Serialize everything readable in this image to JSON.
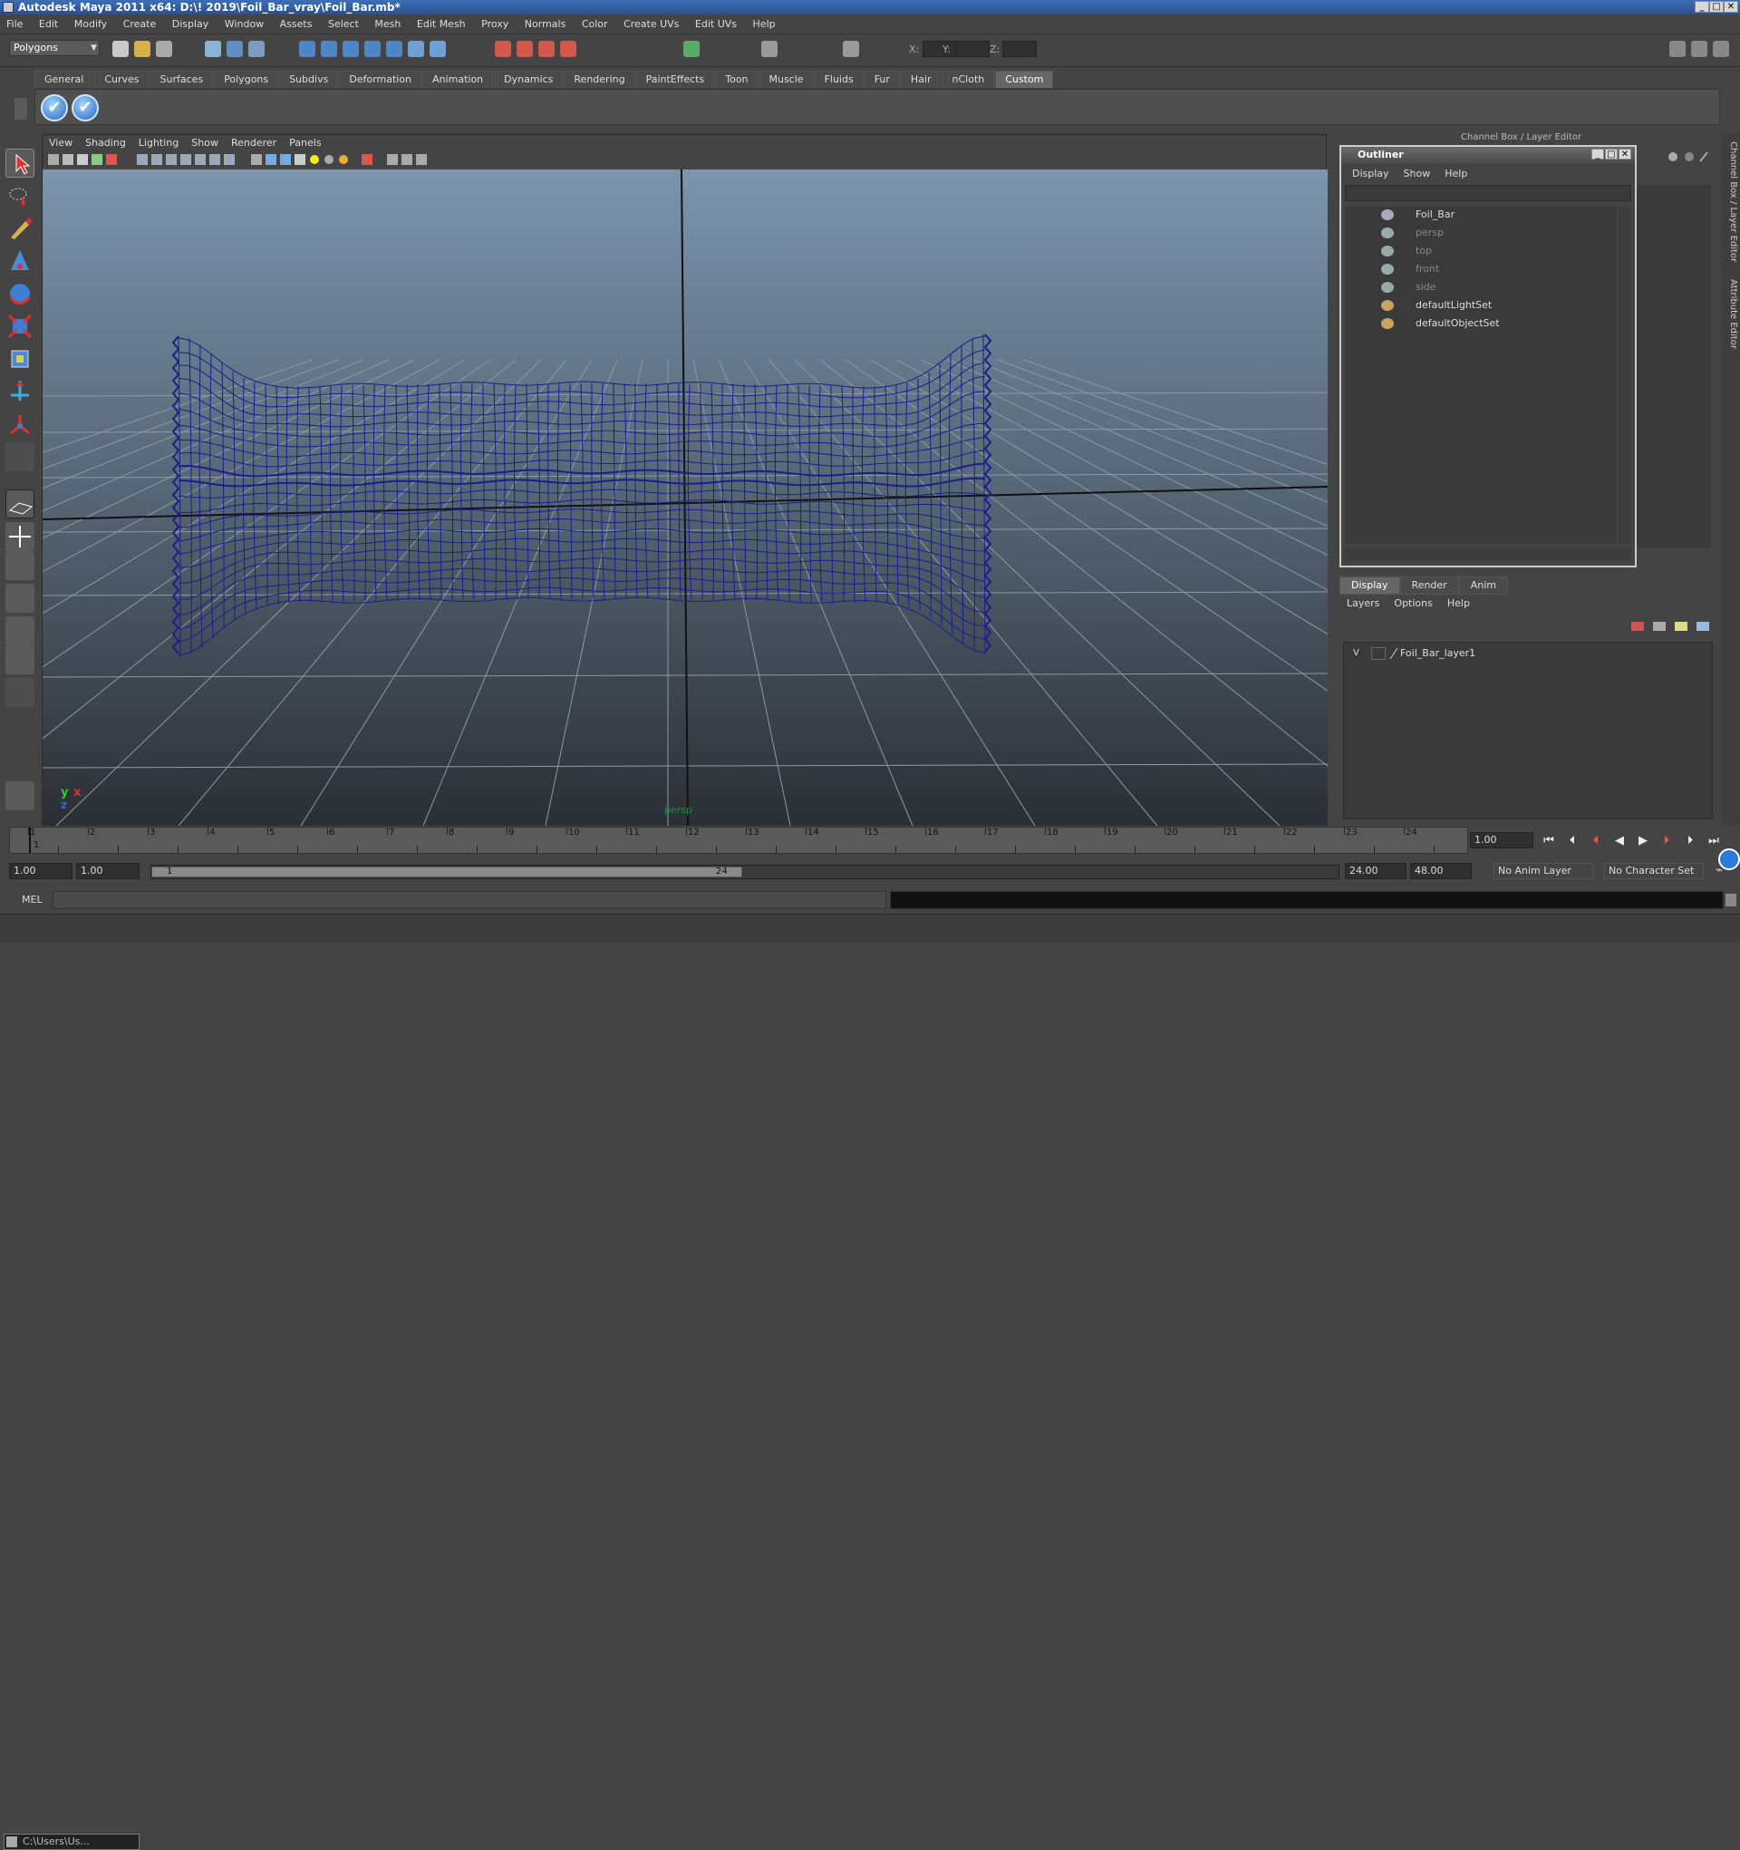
{
  "window": {
    "title": "Autodesk Maya 2011 x64: D:\\! 2019\\Foil_Bar_vray\\Foil_Bar.mb*",
    "minimize": "_",
    "maximize": "□",
    "close": "✕"
  },
  "menubar": [
    "File",
    "Edit",
    "Modify",
    "Create",
    "Display",
    "Window",
    "Assets",
    "Select",
    "Mesh",
    "Edit Mesh",
    "Proxy",
    "Normals",
    "Color",
    "Create UVs",
    "Edit UVs",
    "Help"
  ],
  "statusline": {
    "mode": "Polygons",
    "x_label": "X:",
    "y_label": "Y:",
    "z_label": "Z:"
  },
  "shelf": {
    "tabs": [
      "General",
      "Curves",
      "Surfaces",
      "Polygons",
      "Subdivs",
      "Deformation",
      "Animation",
      "Dynamics",
      "Rendering",
      "PaintEffects",
      "Toon",
      "Muscle",
      "Fluids",
      "Fur",
      "Hair",
      "nCloth",
      "Custom"
    ],
    "active_tab": "Custom",
    "buttons": [
      "✔",
      "✔"
    ]
  },
  "viewport": {
    "menus": [
      "View",
      "Shading",
      "Lighting",
      "Show",
      "Renderer",
      "Panels"
    ],
    "camera_label": "persp",
    "axis_y": "y",
    "axis_x": "x",
    "axis_z": "z",
    "wire_color": "#1a1e8a"
  },
  "channelbox": {
    "title": "Channel Box / Layer Editor"
  },
  "outliner": {
    "title": "Outliner",
    "menus": [
      "Display",
      "Show",
      "Help"
    ],
    "items": [
      {
        "label": "Foil_Bar",
        "dim": false
      },
      {
        "label": "persp",
        "dim": true
      },
      {
        "label": "top",
        "dim": true
      },
      {
        "label": "front",
        "dim": true
      },
      {
        "label": "side",
        "dim": true
      },
      {
        "label": "defaultLightSet",
        "dim": false
      },
      {
        "label": "defaultObjectSet",
        "dim": false
      }
    ]
  },
  "layer_editor": {
    "tabs": [
      "Display",
      "Render",
      "Anim"
    ],
    "active_tab": "Display",
    "menus": [
      "Layers",
      "Options",
      "Help"
    ],
    "layer_visible": "V",
    "layer_name": "Foil_Bar_layer1"
  },
  "side_tabs": [
    "Channel Box / Layer Editor",
    "Attribute Editor"
  ],
  "timeslider": {
    "ticks": [
      "1",
      "2",
      "3",
      "4",
      "5",
      "6",
      "7",
      "8",
      "9",
      "10",
      "11",
      "12",
      "13",
      "14",
      "15",
      "16",
      "17",
      "18",
      "19",
      "20",
      "21",
      "22",
      "23",
      "24"
    ],
    "current_frame": "1.00",
    "current_marker": "1"
  },
  "range": {
    "start_time": "1.00",
    "playback_start": "1.00",
    "range_start_label": "1",
    "range_end_label": "24",
    "playback_end": "24.00",
    "end_time": "48.00",
    "anim_layer": "No Anim Layer",
    "character_set": "No Character Set"
  },
  "command": {
    "label": "MEL"
  },
  "taskbar": {
    "item": "C:\\Users\\Us..."
  }
}
